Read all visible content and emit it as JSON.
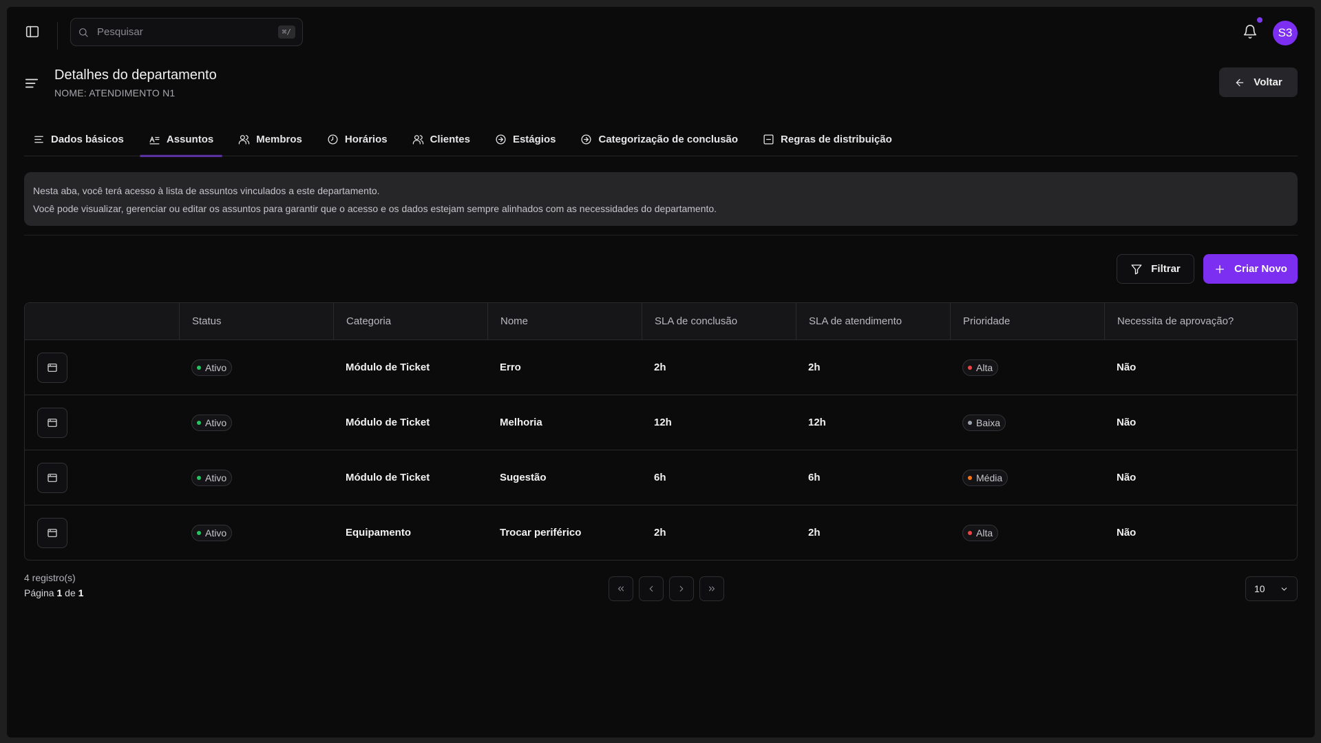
{
  "topbar": {
    "search_placeholder": "Pesquisar",
    "search_shortcut": "⌘/",
    "avatar_initials": "S3"
  },
  "header": {
    "title": "Detalhes do departamento",
    "subtitle": "NOME: ATENDIMENTO N1",
    "back_label": "Voltar"
  },
  "tabs": [
    {
      "label": "Dados básicos",
      "icon": "list-icon"
    },
    {
      "label": "Assuntos",
      "icon": "subjects-icon",
      "active": true
    },
    {
      "label": "Membros",
      "icon": "users-icon"
    },
    {
      "label": "Horários",
      "icon": "clock-icon"
    },
    {
      "label": "Clientes",
      "icon": "clients-icon"
    },
    {
      "label": "Estágios",
      "icon": "arrow-circle-icon"
    },
    {
      "label": "Categorização de conclusão",
      "icon": "arrow-circle-icon"
    },
    {
      "label": "Regras de distribuição",
      "icon": "rules-icon"
    }
  ],
  "info": {
    "line1": "Nesta aba, você terá acesso à lista de assuntos vinculados a este departamento.",
    "line2": "Você pode visualizar, gerenciar ou editar os assuntos para garantir que o acesso e os dados estejam sempre alinhados com as necessidades do departamento."
  },
  "actions": {
    "filter_label": "Filtrar",
    "create_label": "Criar Novo"
  },
  "table": {
    "columns": [
      "",
      "Status",
      "Categoria",
      "Nome",
      "SLA de conclusão",
      "SLA de atendimento",
      "Prioridade",
      "Necessita de aprovação?"
    ],
    "rows": [
      {
        "status": "Ativo",
        "category": "Módulo de Ticket",
        "name": "Erro",
        "sla_conclusion": "2h",
        "sla_service": "2h",
        "priority": "Alta",
        "priority_color": "#ef4444",
        "approval": "Não"
      },
      {
        "status": "Ativo",
        "category": "Módulo de Ticket",
        "name": "Melhoria",
        "sla_conclusion": "12h",
        "sla_service": "12h",
        "priority": "Baixa",
        "priority_color": "#9ca3af",
        "approval": "Não"
      },
      {
        "status": "Ativo",
        "category": "Módulo de Ticket",
        "name": "Sugestão",
        "sla_conclusion": "6h",
        "sla_service": "6h",
        "priority": "Média",
        "priority_color": "#f97316",
        "approval": "Não"
      },
      {
        "status": "Ativo",
        "category": "Equipamento",
        "name": "Trocar periférico",
        "sla_conclusion": "2h",
        "sla_service": "2h",
        "priority": "Alta",
        "priority_color": "#ef4444",
        "approval": "Não"
      }
    ]
  },
  "colors": {
    "accent": "#7c2ff0",
    "status_active": "#22c55e"
  },
  "pagination": {
    "records": "4 registro(s)",
    "page_prefix": "Página",
    "page_current": "1",
    "page_of": "de",
    "page_total": "1",
    "per_page": "10"
  }
}
